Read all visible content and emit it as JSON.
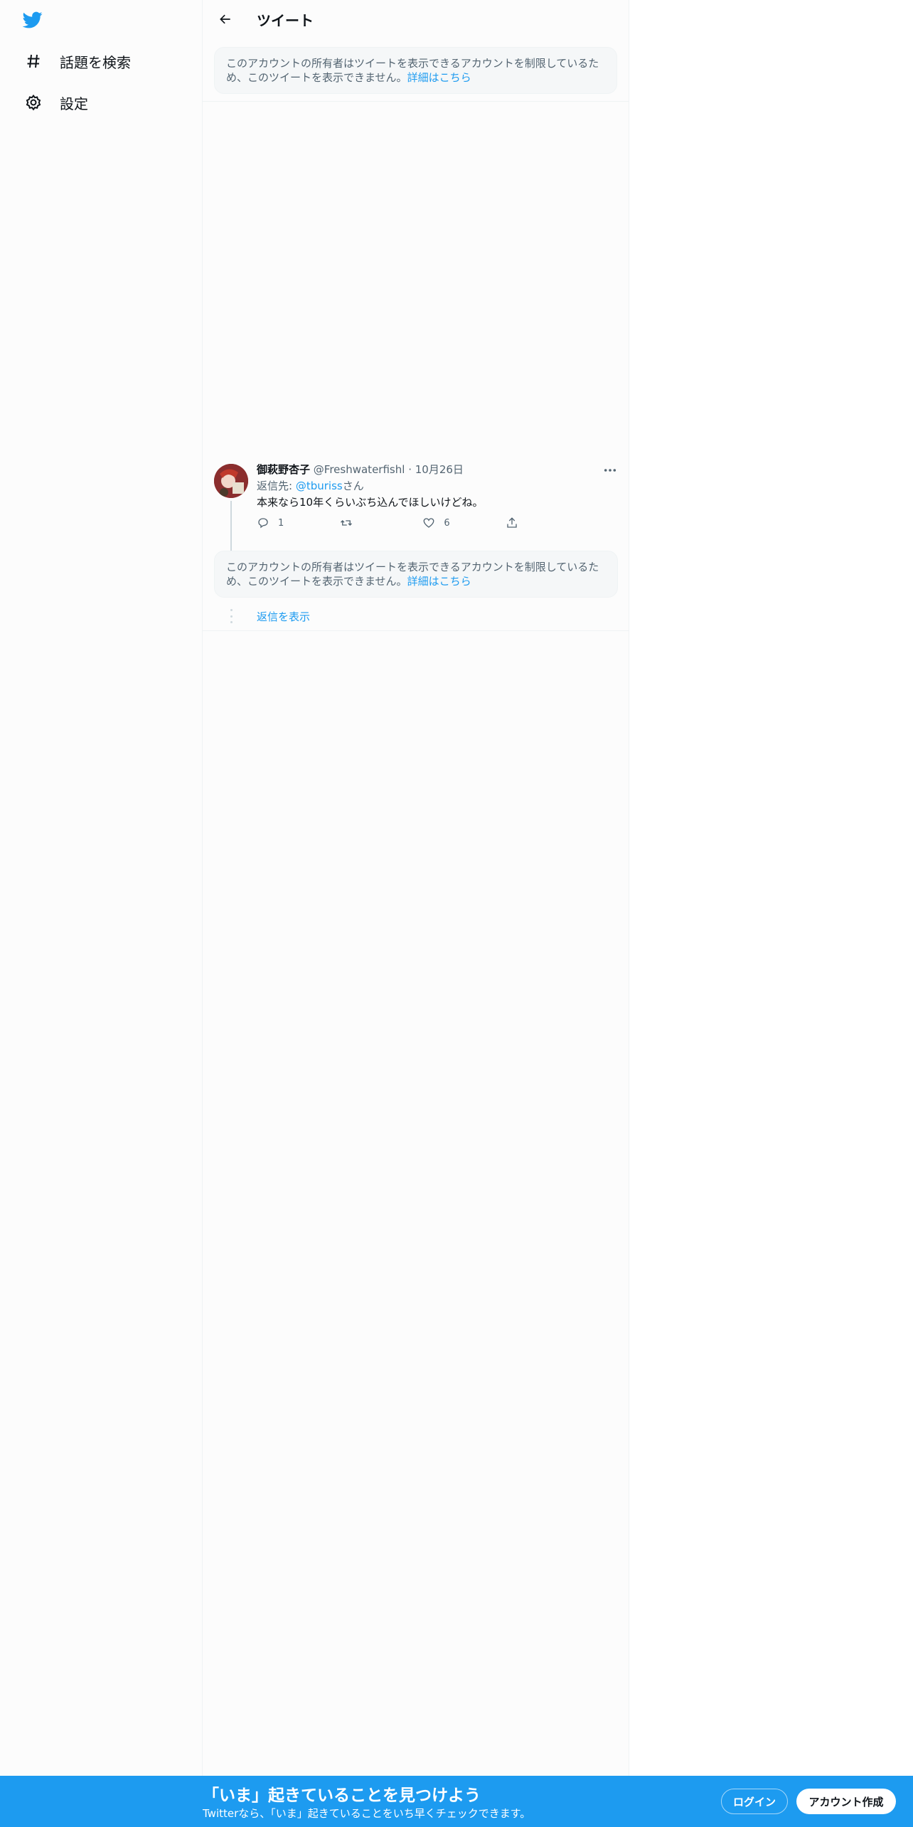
{
  "sidebar": {
    "items": [
      {
        "label": "話題を検索",
        "icon": "hashtag-icon"
      },
      {
        "label": "設定",
        "icon": "gear-icon"
      }
    ]
  },
  "header": {
    "title": "ツイート"
  },
  "notices": {
    "text": "このアカウントの所有者はツイートを表示できるアカウントを制限しているため、このツイートを表示できません。",
    "link": "詳細はこちら"
  },
  "tweet": {
    "name": "御萩野杏子",
    "handle": "@Freshwaterfishl",
    "separator": "·",
    "date": "10月26日",
    "reply_prefix": "返信先: ",
    "reply_handle": "@tburiss",
    "reply_suffix": "さん",
    "text": "本来なら10年くらいぶち込んでほしいけどね。",
    "reply_count": "1",
    "like_count": "6"
  },
  "show_replies": "返信を表示",
  "banner": {
    "title": "「いま」起きていることを見つけよう",
    "subtitle": "Twitterなら、「いま」起きていることをいち早くチェックできます。",
    "login": "ログイン",
    "signup": "アカウント作成"
  },
  "colors": {
    "accent": "#1d9bf0",
    "text": "#0f1419",
    "muted": "#536471"
  }
}
